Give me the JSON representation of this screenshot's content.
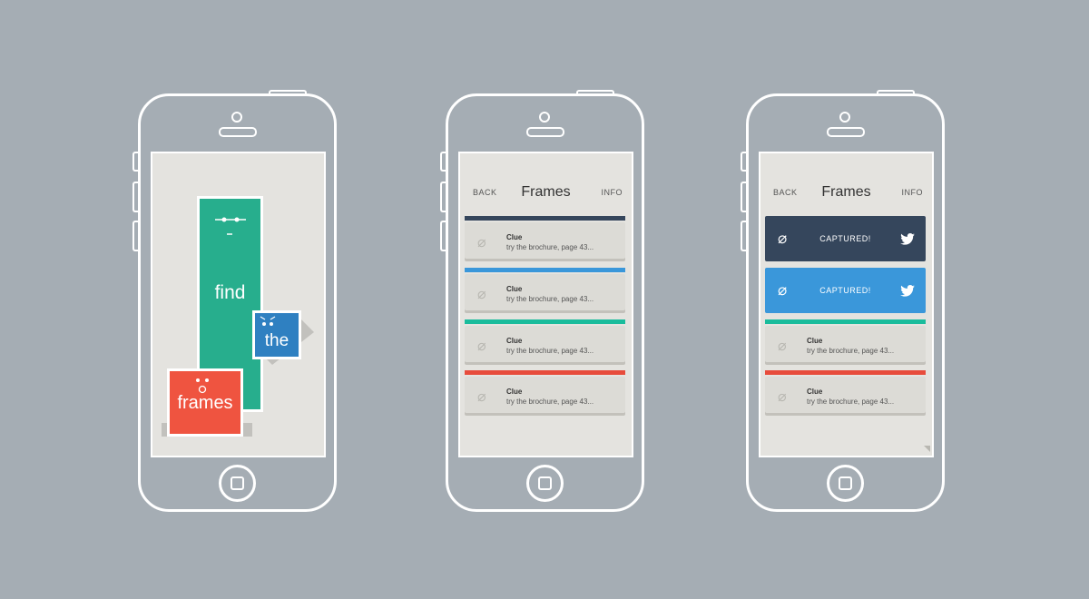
{
  "colors": {
    "background": "#a5adb4",
    "green": "#27ae8d",
    "blue": "#2f80c1",
    "red": "#ef5440",
    "navy": "#35465c",
    "sky": "#3a97da",
    "teal": "#1abc9c",
    "crimson": "#e74c3c"
  },
  "splash": {
    "word_find": "find",
    "word_the": "the",
    "word_frames": "frames"
  },
  "list": {
    "back": "BACK",
    "title": "Frames",
    "info": "INFO",
    "items": [
      {
        "stripe": "#35465c",
        "title": "Clue",
        "hint": "try the brochure, page 43..."
      },
      {
        "stripe": "#3a97da",
        "title": "Clue",
        "hint": "try the brochure, page 43..."
      },
      {
        "stripe": "#1abc9c",
        "title": "Clue",
        "hint": "try the brochure, page 43..."
      },
      {
        "stripe": "#e74c3c",
        "title": "Clue",
        "hint": "try the brochure, page 43..."
      }
    ]
  },
  "captured_screen": {
    "back": "BACK",
    "title": "Frames",
    "info": "INFO",
    "captured": [
      {
        "label": "CAPTURED!",
        "color": "#35465c",
        "icon": "twitter-icon"
      },
      {
        "label": "CAPTURED!",
        "color": "#3a97da",
        "icon": "twitter-icon"
      }
    ],
    "items": [
      {
        "stripe": "#1abc9c",
        "title": "Clue",
        "hint": "try the brochure, page 43..."
      },
      {
        "stripe": "#e74c3c",
        "title": "Clue",
        "hint": "try the brochure, page 43..."
      }
    ]
  }
}
